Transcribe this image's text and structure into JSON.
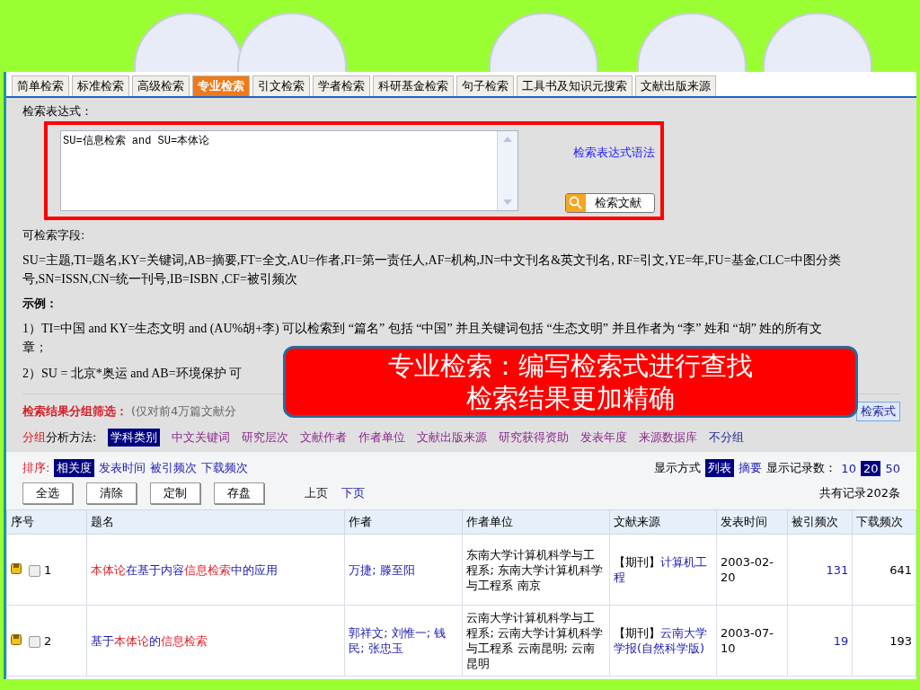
{
  "tabs": [
    {
      "label": "简单检索",
      "selected": false
    },
    {
      "label": "标准检索",
      "selected": false
    },
    {
      "label": "高级检索",
      "selected": false
    },
    {
      "label": "专业检索",
      "selected": true
    },
    {
      "label": "引文检索",
      "selected": false
    },
    {
      "label": "学者检索",
      "selected": false
    },
    {
      "label": "科研基金检索",
      "selected": false
    },
    {
      "label": "句子检索",
      "selected": false
    },
    {
      "label": "工具书及知识元搜索",
      "selected": false
    },
    {
      "label": "文献出版来源",
      "selected": false
    }
  ],
  "expression": {
    "label": "检索表达式：",
    "value": "SU=信息检索 and SU=本体论",
    "syntax_link": "检索表达式语法",
    "search_button": "检索文献"
  },
  "fields": {
    "label": "可检索字段:",
    "text": "SU=主题,TI=题名,KY=关键词,AB=摘要,FT=全文,AU=作者,FI=第一责任人,AF=机构,JN=中文刊名&英文刊名, RF=引文,YE=年,FU=基金,CLC=中图分类号,SN=ISSN,CN=统一刊号,IB=ISBN ,CF=被引频次"
  },
  "examples": {
    "label": "示例：",
    "items": [
      "1）TI=中国  and KY=生态文明  and (AU%胡+李) 可以检索到 “篇名” 包括 “中国” 并且关键词包括 “生态文明” 并且作者为 “李” 姓和 “胡” 姓的所有文章；",
      "2）SU = 北京*奥运  and AB=环境保护  可"
    ]
  },
  "grouping": {
    "title": "检索结果分组筛选：",
    "note": "(仅对前4万篇文献分",
    "save_button": "检索式",
    "method_prefix": "分组",
    "method_label": "分析方法:",
    "methods": [
      {
        "label": "学科类别",
        "selected": true
      },
      {
        "label": "中文关键词",
        "selected": false
      },
      {
        "label": "研究层次",
        "selected": false
      },
      {
        "label": "文献作者",
        "selected": false
      },
      {
        "label": "作者单位",
        "selected": false
      },
      {
        "label": "文献出版来源",
        "selected": false
      },
      {
        "label": "研究获得资助",
        "selected": false
      },
      {
        "label": "发表年度",
        "selected": false
      },
      {
        "label": "来源数据库",
        "selected": false
      },
      {
        "label": "不分组",
        "selected": false
      }
    ]
  },
  "sort": {
    "label": "排序:",
    "options": [
      {
        "label": "相关度",
        "selected": true
      },
      {
        "label": "发表时间",
        "selected": false
      },
      {
        "label": "被引频次",
        "selected": false
      },
      {
        "label": "下载频次",
        "selected": false
      }
    ]
  },
  "display": {
    "label": "显示方式",
    "modes": [
      {
        "label": "列表",
        "selected": true
      },
      {
        "label": "摘要",
        "selected": false
      }
    ],
    "count_label": "显示记录数：",
    "counts": [
      {
        "label": "10",
        "selected": false
      },
      {
        "label": "20",
        "selected": true
      },
      {
        "label": "50",
        "selected": false
      }
    ]
  },
  "actions": [
    "全选",
    "清除",
    "定制",
    "存盘"
  ],
  "pager": {
    "prev": "上页",
    "next": "下页"
  },
  "total": "共有记录202条",
  "table": {
    "columns": [
      "序号",
      "题名",
      "作者",
      "作者单位",
      "文献来源",
      "发表时间",
      "被引频次",
      "下载频次"
    ],
    "rows": [
      {
        "number": "1",
        "checked": false,
        "title": [
          {
            "text": "本体论",
            "highlight": true
          },
          {
            "text": "在基于内容",
            "highlight": false
          },
          {
            "text": "信息检索",
            "highlight": true
          },
          {
            "text": "中的应用",
            "highlight": false
          }
        ],
        "authors": "万捷; 滕至阳",
        "affiliation": "东南大学计算机科学与工程系; 东南大学计算机科学与工程系  南京",
        "source_type": "【期刊】",
        "source": "计算机工程",
        "date": "2003-02-20",
        "citations": "131",
        "downloads": "641"
      },
      {
        "number": "2",
        "checked": false,
        "title": [
          {
            "text": "基于",
            "highlight": false
          },
          {
            "text": "本体论",
            "highlight": true
          },
          {
            "text": "的",
            "highlight": false
          },
          {
            "text": "信息检索",
            "highlight": true
          }
        ],
        "authors": "郭祥文; 刘惟一; 钱民; 张忠玉",
        "affiliation": "云南大学计算机科学与工程系; 云南大学计算机科学与工程系  云南昆明; 云南昆明",
        "source_type": "【期刊】",
        "source": "云南大学学报(自然科学版)",
        "date": "2003-07-10",
        "citations": "19",
        "downloads": "193"
      }
    ]
  },
  "callout": {
    "lines": [
      "专业检索：编写检索式进行查找",
      "检索结果更加精确"
    ]
  }
}
